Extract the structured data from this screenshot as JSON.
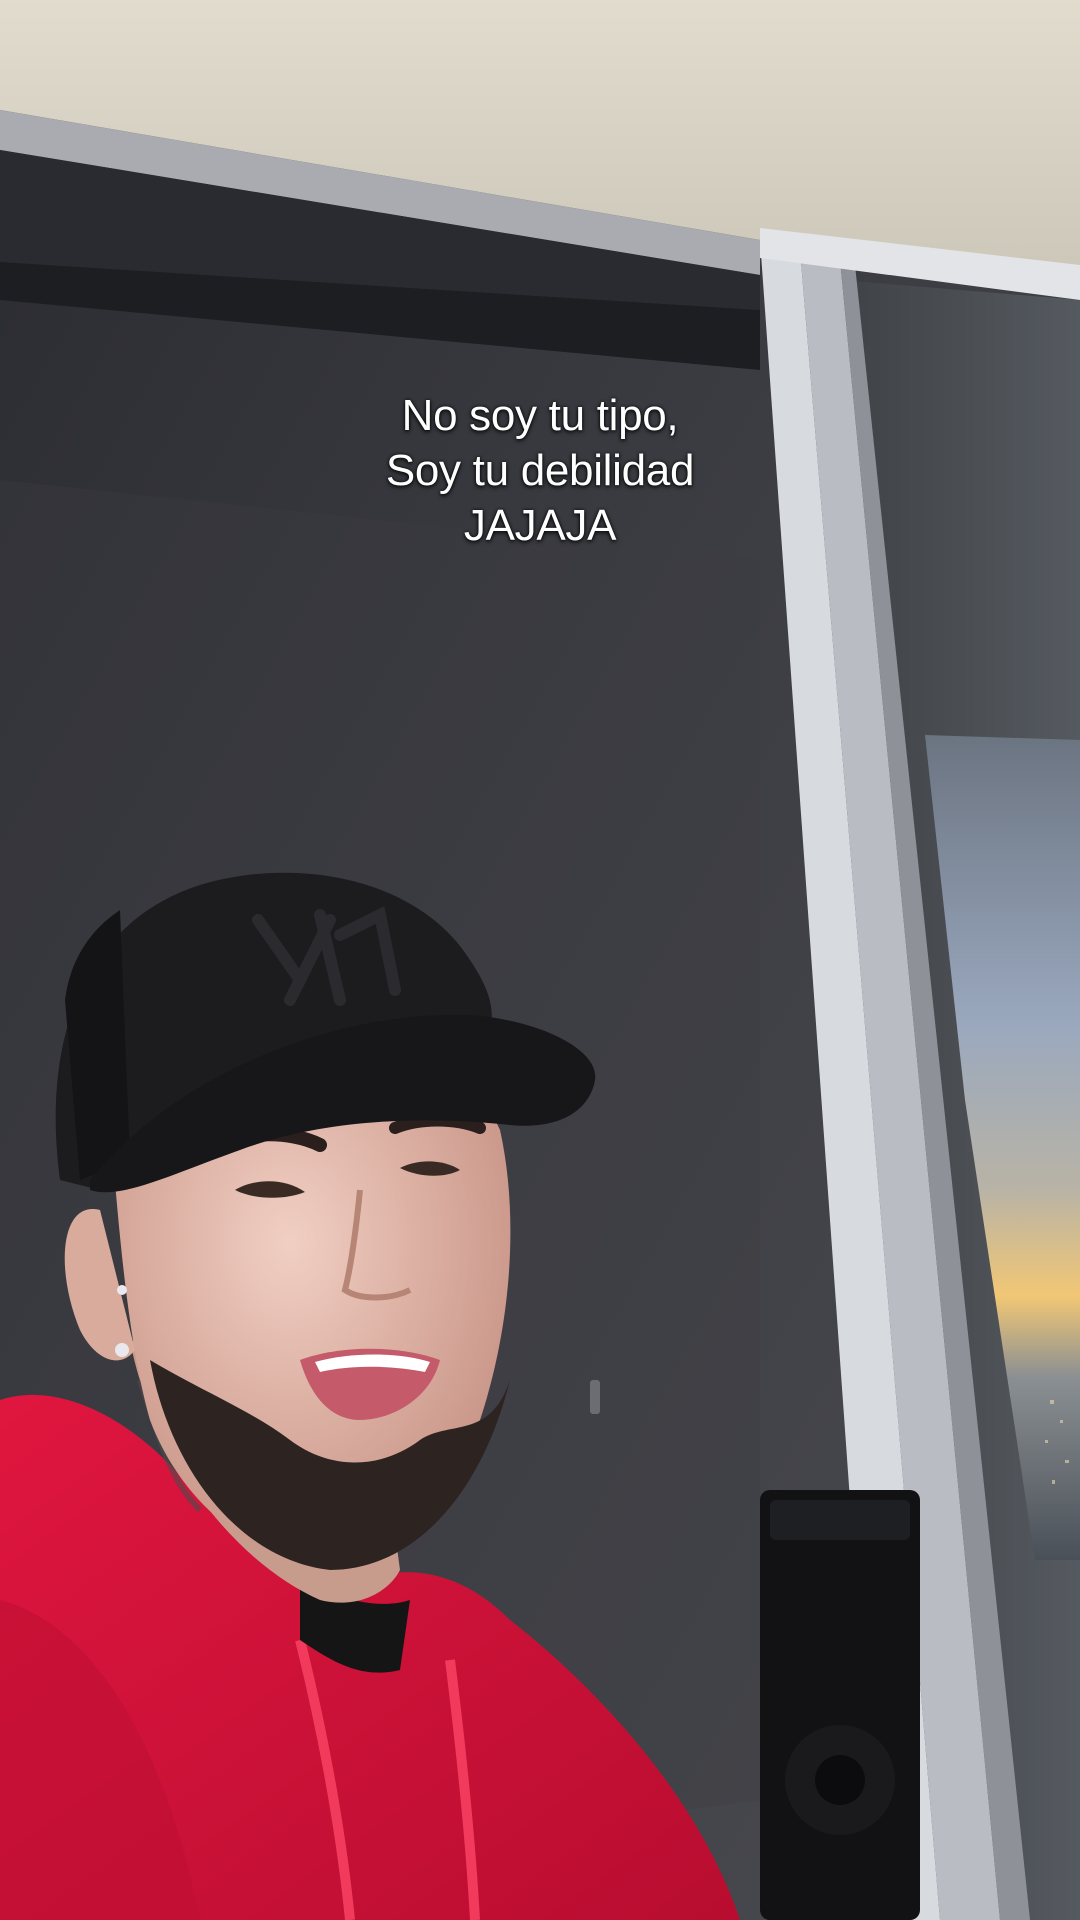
{
  "caption": {
    "lines": [
      "No soy tu tipo,",
      "Soy tu debilidad",
      "JAJAJA"
    ]
  },
  "colors": {
    "hoodie": "#d4123a",
    "cap": "#1c1c1f",
    "wall": "#3a3b40",
    "ceiling": "#d8d3c6",
    "window_frame": "#c9ccd1",
    "sky": "#8d9bb0",
    "sunset": "#f0c271"
  }
}
